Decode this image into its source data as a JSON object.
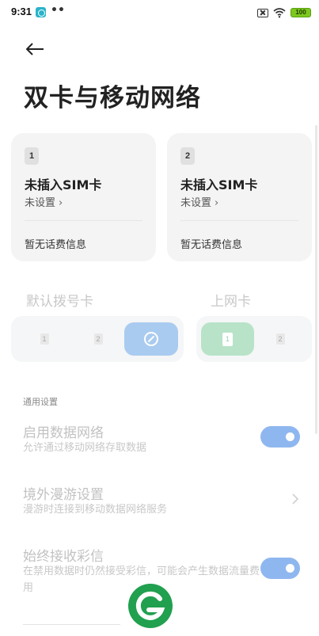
{
  "status_bar": {
    "time": "9:31",
    "dots": "••",
    "battery": "100"
  },
  "header": {
    "title": "双卡与移动网络"
  },
  "sim_cards": [
    {
      "slot": "1",
      "status": "未插入SIM卡",
      "setting": "未设置",
      "balance": "暂无话费信息"
    },
    {
      "slot": "2",
      "status": "未插入SIM卡",
      "setting": "未设置",
      "balance": "暂无话费信息"
    }
  ],
  "default_dial": {
    "label": "默认拨号卡",
    "options": [
      "1",
      "2"
    ],
    "selected": "auto"
  },
  "data_sim": {
    "label": "上网卡",
    "options": [
      "1",
      "2"
    ],
    "selected": "1"
  },
  "general": {
    "group_label": "通用设置",
    "items": [
      {
        "title": "启用数据网络",
        "subtitle": "允许通过移动网络存取数据",
        "control": "toggle",
        "on": true
      },
      {
        "title": "境外漫游设置",
        "subtitle": "漫游时连接到移动数据网络服务",
        "control": "chevron"
      },
      {
        "title": "始终接收彩信",
        "subtitle": "在禁用数据时仍然接受彩信，可能会产生数据流量费用",
        "control": "toggle",
        "on": true
      }
    ]
  },
  "colors": {
    "toggle_on": "#8fb7ef",
    "selected_dial": "#aacbf0",
    "selected_data": "#b8e3c8",
    "logo_green": "#21a04f"
  }
}
